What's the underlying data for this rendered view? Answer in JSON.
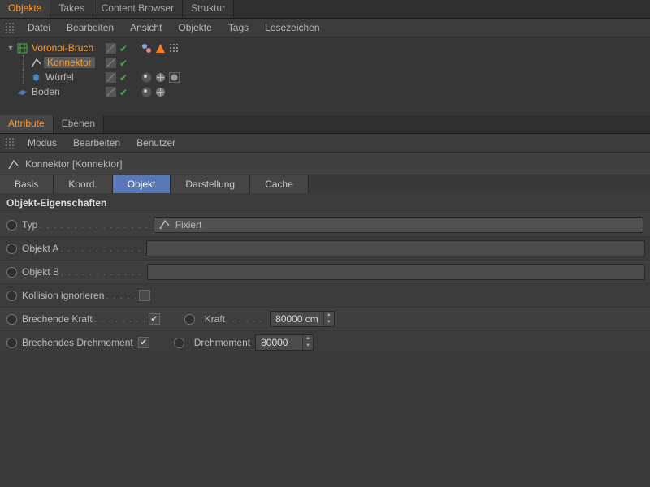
{
  "topTabs": {
    "objekte": "Objekte",
    "takes": "Takes",
    "contentBrowser": "Content Browser",
    "struktur": "Struktur"
  },
  "menuTop": {
    "datei": "Datei",
    "bearbeiten": "Bearbeiten",
    "ansicht": "Ansicht",
    "objekte": "Objekte",
    "tags": "Tags",
    "lesezeichen": "Lesezeichen"
  },
  "tree": {
    "items": [
      {
        "name": "Voronoi-Bruch",
        "kind": "voronoi",
        "selected": "name-orange"
      },
      {
        "name": "Konnektor",
        "kind": "connector",
        "selected": "highlight"
      },
      {
        "name": "Würfel",
        "kind": "cube",
        "selected": "none"
      },
      {
        "name": "Boden",
        "kind": "floor",
        "selected": "none"
      }
    ]
  },
  "attrTabs": {
    "attribute": "Attribute",
    "ebenen": "Ebenen"
  },
  "menuAttr": {
    "modus": "Modus",
    "bearbeiten": "Bearbeiten",
    "benutzer": "Benutzer"
  },
  "headerTitle": "Konnektor [Konnektor]",
  "subtabs": {
    "basis": "Basis",
    "koord": "Koord.",
    "objekt": "Objekt",
    "darstellung": "Darstellung",
    "cache": "Cache"
  },
  "sectionTitle": "Objekt-Eigenschaften",
  "props": {
    "typLabel": "Typ",
    "typValue": "Fixiert",
    "objALabel": "Objekt A",
    "objBLabel": "Objekt B",
    "kollisionLabel": "Kollision ignorieren",
    "brechKraftLabel": "Brechende Kraft",
    "kraftLabel": "Kraft",
    "kraftValue": "80000 cm",
    "brechDrehLabel": "Brechendes Drehmoment",
    "drehLabel": "Drehmoment",
    "drehValue": "80000",
    "kollisionChecked": false,
    "brechKraftChecked": true,
    "brechDrehChecked": true
  }
}
